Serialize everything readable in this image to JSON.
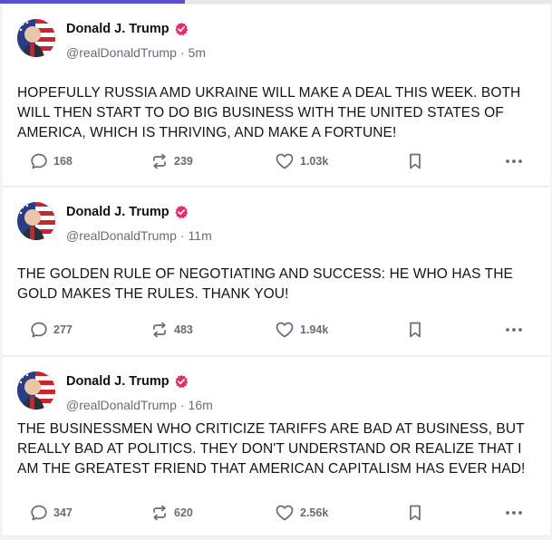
{
  "feed": {
    "posts": [
      {
        "author_name": "Donald J. Trump",
        "handle": "@realDonaldTrump",
        "separator": "·",
        "time": "5m",
        "text": "HOPEFULLY RUSSIA AMD UKRAINE WILL MAKE A DEAL THIS WEEK. BOTH WILL THEN START TO DO BIG BUSINESS WITH THE UNITED STATES OF AMERICA, WHICH IS THRIVING, AND MAKE A FORTUNE!",
        "replies": "168",
        "retruths": "239",
        "likes": "1.03k"
      },
      {
        "author_name": "Donald J. Trump",
        "handle": "@realDonaldTrump",
        "separator": "·",
        "time": "11m",
        "text": "THE GOLDEN RULE OF NEGOTIATING AND SUCCESS: HE WHO HAS THE GOLD MAKES THE RULES. THANK YOU!",
        "replies": "277",
        "retruths": "483",
        "likes": "1.94k"
      },
      {
        "author_name": "Donald J. Trump",
        "handle": "@realDonaldTrump",
        "separator": "·",
        "time": "16m",
        "text": "THE BUSINESSMEN WHO CRITICIZE TARIFFS ARE BAD AT BUSINESS, BUT REALLY BAD AT POLITICS. THEY DON'T UNDERSTAND OR REALIZE THAT I AM THE GREATEST FRIEND THAT AMERICAN CAPITALISM HAS EVER HAD!",
        "replies": "347",
        "retruths": "620",
        "likes": "2.56k"
      }
    ]
  },
  "icons": {
    "reply": "reply-icon",
    "retruth": "retruth-icon",
    "like": "heart-icon",
    "save": "bookmark-icon",
    "more": "more-icon",
    "verified": "verified-badge-icon"
  },
  "colors": {
    "verified_badge": "#e62c6a",
    "accent_bar": "#5d4dd6",
    "muted_text": "#6b6b76"
  },
  "scroll_progress": 0.335
}
